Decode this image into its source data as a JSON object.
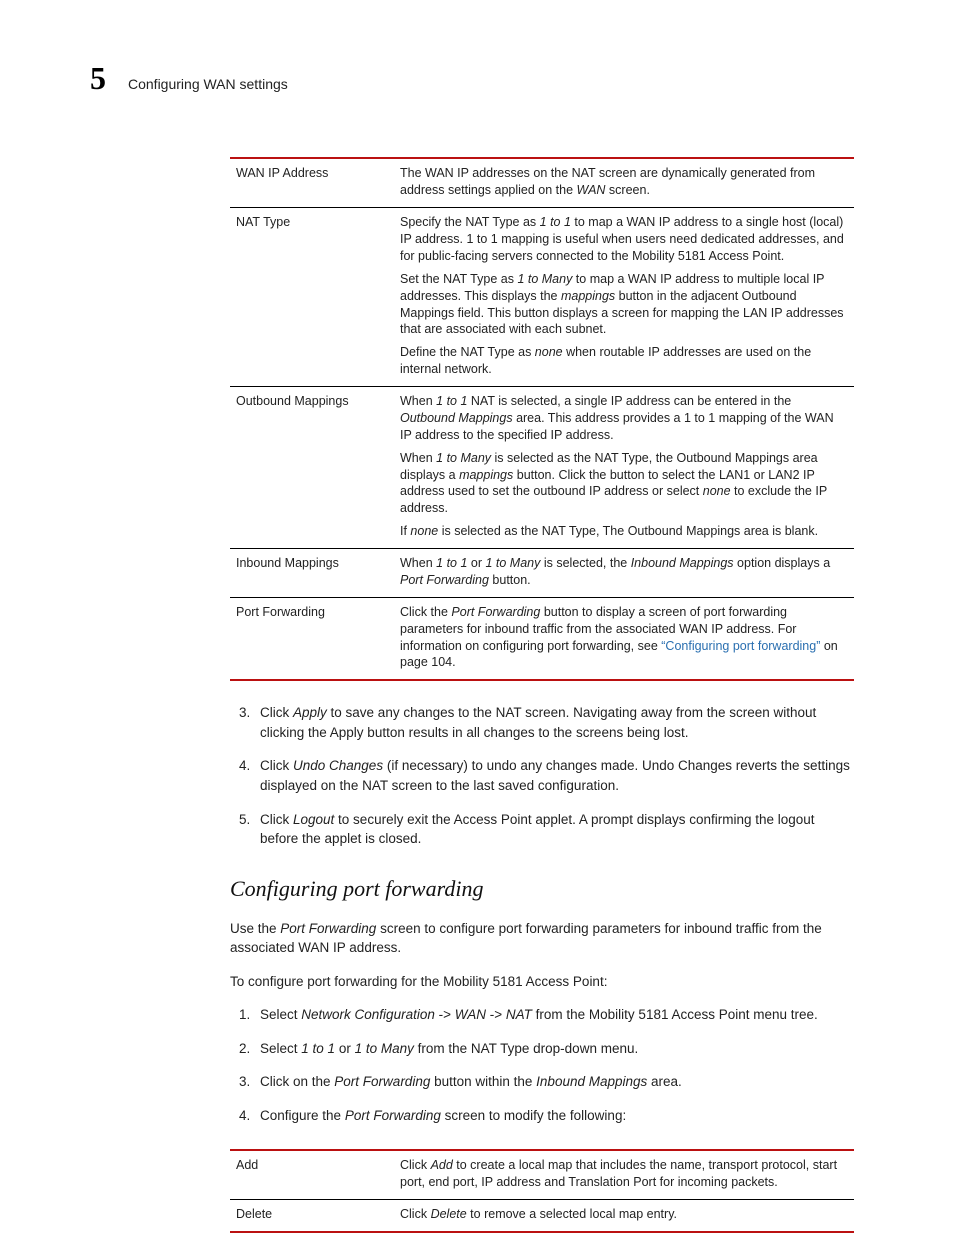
{
  "header": {
    "chapter_number": "5",
    "chapter_title": "Configuring WAN settings"
  },
  "tables": {
    "nat": {
      "rows": [
        {
          "term": "WAN IP Address",
          "desc": [
            "The WAN IP addresses on the NAT screen are dynamically generated from address settings applied on the <em>WAN</em> screen."
          ]
        },
        {
          "term": "NAT Type",
          "desc": [
            "Specify the NAT Type as <em>1 to 1</em> to map a WAN IP address to a single host (local) IP address. 1 to 1 mapping is useful when users need dedicated addresses, and for public-facing servers connected to the Mobility 5181 Access Point.",
            "Set the NAT Type as <em>1 to Many</em> to map a WAN IP address to multiple local IP addresses. This displays the <em>mappings</em> button in the adjacent Outbound Mappings field. This button displays a screen for mapping the LAN IP addresses that are associated with each subnet.",
            "Define the NAT Type as <em>none</em> when routable IP addresses are used on the internal network."
          ]
        },
        {
          "term": "Outbound Mappings",
          "desc": [
            "When <em>1 to 1</em> NAT is selected, a single IP address can be entered in the <em>Outbound Mappings</em> area. This address provides a 1 to 1 mapping of the WAN IP address to the specified IP address.",
            "When <em>1 to Many</em> is selected as the NAT Type, the Outbound Mappings area displays a <em>mappings</em> button. Click the button to select the LAN1 or LAN2 IP address used to set the outbound IP address or select <em>none</em> to exclude the IP address.",
            "If <em>none</em> is selected as the NAT Type, The Outbound Mappings area is blank."
          ]
        },
        {
          "term": "Inbound Mappings",
          "desc": [
            "When <em>1 to 1</em> or <em>1 to Many</em> is selected, the <em>Inbound Mappings</em> option displays a <em>Port Forwarding</em> button."
          ]
        },
        {
          "term": "Port Forwarding",
          "desc": [
            "Click the <em>Port Forwarding</em> button to display a screen of port forwarding parameters for inbound traffic from the associated WAN IP address. For information on configuring port forwarding, see <span class=\"link\">“Configuring port forwarding”</span> on page 104."
          ]
        }
      ]
    },
    "pf": {
      "rows": [
        {
          "term": "Add",
          "desc": [
            "Click <em>Add</em> to create a local map that includes the name, transport protocol, start port, end port, IP address and Translation Port for incoming packets."
          ]
        },
        {
          "term": "Delete",
          "desc": [
            "Click <em>Delete</em> to remove a selected local map entry."
          ]
        }
      ]
    }
  },
  "steps_a": [
    "Click <em>Apply</em> to save any changes to the NAT screen. Navigating away from the screen without clicking the Apply button results in all changes to the screens being lost.",
    "Click <em>Undo Changes</em> (if necessary) to undo any changes made. Undo Changes reverts the settings displayed on the NAT screen to the last saved configuration.",
    "Click <em>Logout</em> to securely exit the Access Point applet. A prompt displays confirming the logout before the applet is closed."
  ],
  "section_b": {
    "heading": "Configuring port forwarding",
    "intro": "Use the <em>Port Forwarding</em> screen to configure port forwarding parameters for inbound traffic from the associated WAN IP address.",
    "lead": "To configure port forwarding for the Mobility 5181 Access Point:"
  },
  "steps_b": [
    "Select <em>Network Configuration</em> -> <em>WAN</em> -> <em>NAT</em> from the Mobility 5181 Access Point menu tree.",
    "Select <em>1 to 1</em> or <em>1 to Many</em> from the NAT Type drop-down menu.",
    "Click on the <em>Port Forwarding</em> button within the <em>Inbound Mappings</em> area.",
    "Configure the <em>Port Forwarding</em> screen to modify the following:"
  ]
}
